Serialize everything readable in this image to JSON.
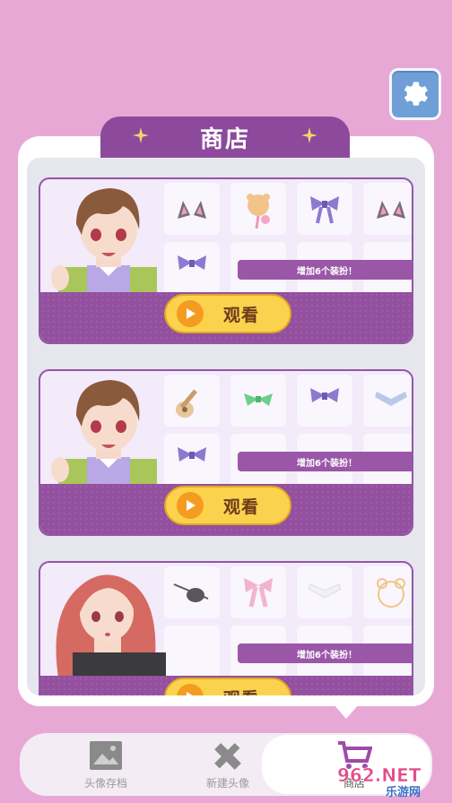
{
  "header": {
    "title": "商店"
  },
  "settings": {
    "icon": "gear-icon",
    "color": "#6f9fd6"
  },
  "cards": [
    {
      "banner": "增加6个装扮！",
      "button_label": "观看"
    },
    {
      "banner": "增加6个装扮！",
      "button_label": "观看"
    },
    {
      "banner": "增加6个装扮！",
      "button_label": "观看"
    }
  ],
  "nav": {
    "items": [
      {
        "label": "头像存档",
        "icon": "image-icon"
      },
      {
        "label": "新建头像",
        "icon": "pencil-ruler-icon"
      },
      {
        "label": "商店",
        "icon": "cart-icon"
      }
    ]
  },
  "watermark": {
    "brand": "962.NET",
    "text": "乐游网"
  },
  "colors": {
    "accent": "#93509f",
    "background": "#e8a8d6",
    "button": "#fbd24d"
  }
}
